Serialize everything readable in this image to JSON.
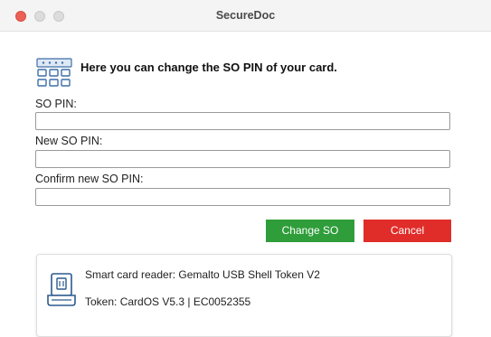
{
  "window": {
    "title": "SecureDoc"
  },
  "header": {
    "text": "Here you can change the SO PIN of your card.",
    "icon": "keypad-icon"
  },
  "form": {
    "so_pin_label": "SO PIN:",
    "so_pin_value": "",
    "new_so_pin_label": "New SO PIN:",
    "new_so_pin_value": "",
    "confirm_so_pin_label": "Confirm new SO PIN:",
    "confirm_so_pin_value": ""
  },
  "buttons": {
    "change_label": "Change SO",
    "cancel_label": "Cancel",
    "change_color": "#2f9d3a",
    "cancel_color": "#e02d2a"
  },
  "card_info": {
    "icon": "card-reader-icon",
    "reader": "Smart card reader: Gemalto USB Shell Token V2",
    "token": "Token: CardOS V5.3 | EC0052355"
  }
}
